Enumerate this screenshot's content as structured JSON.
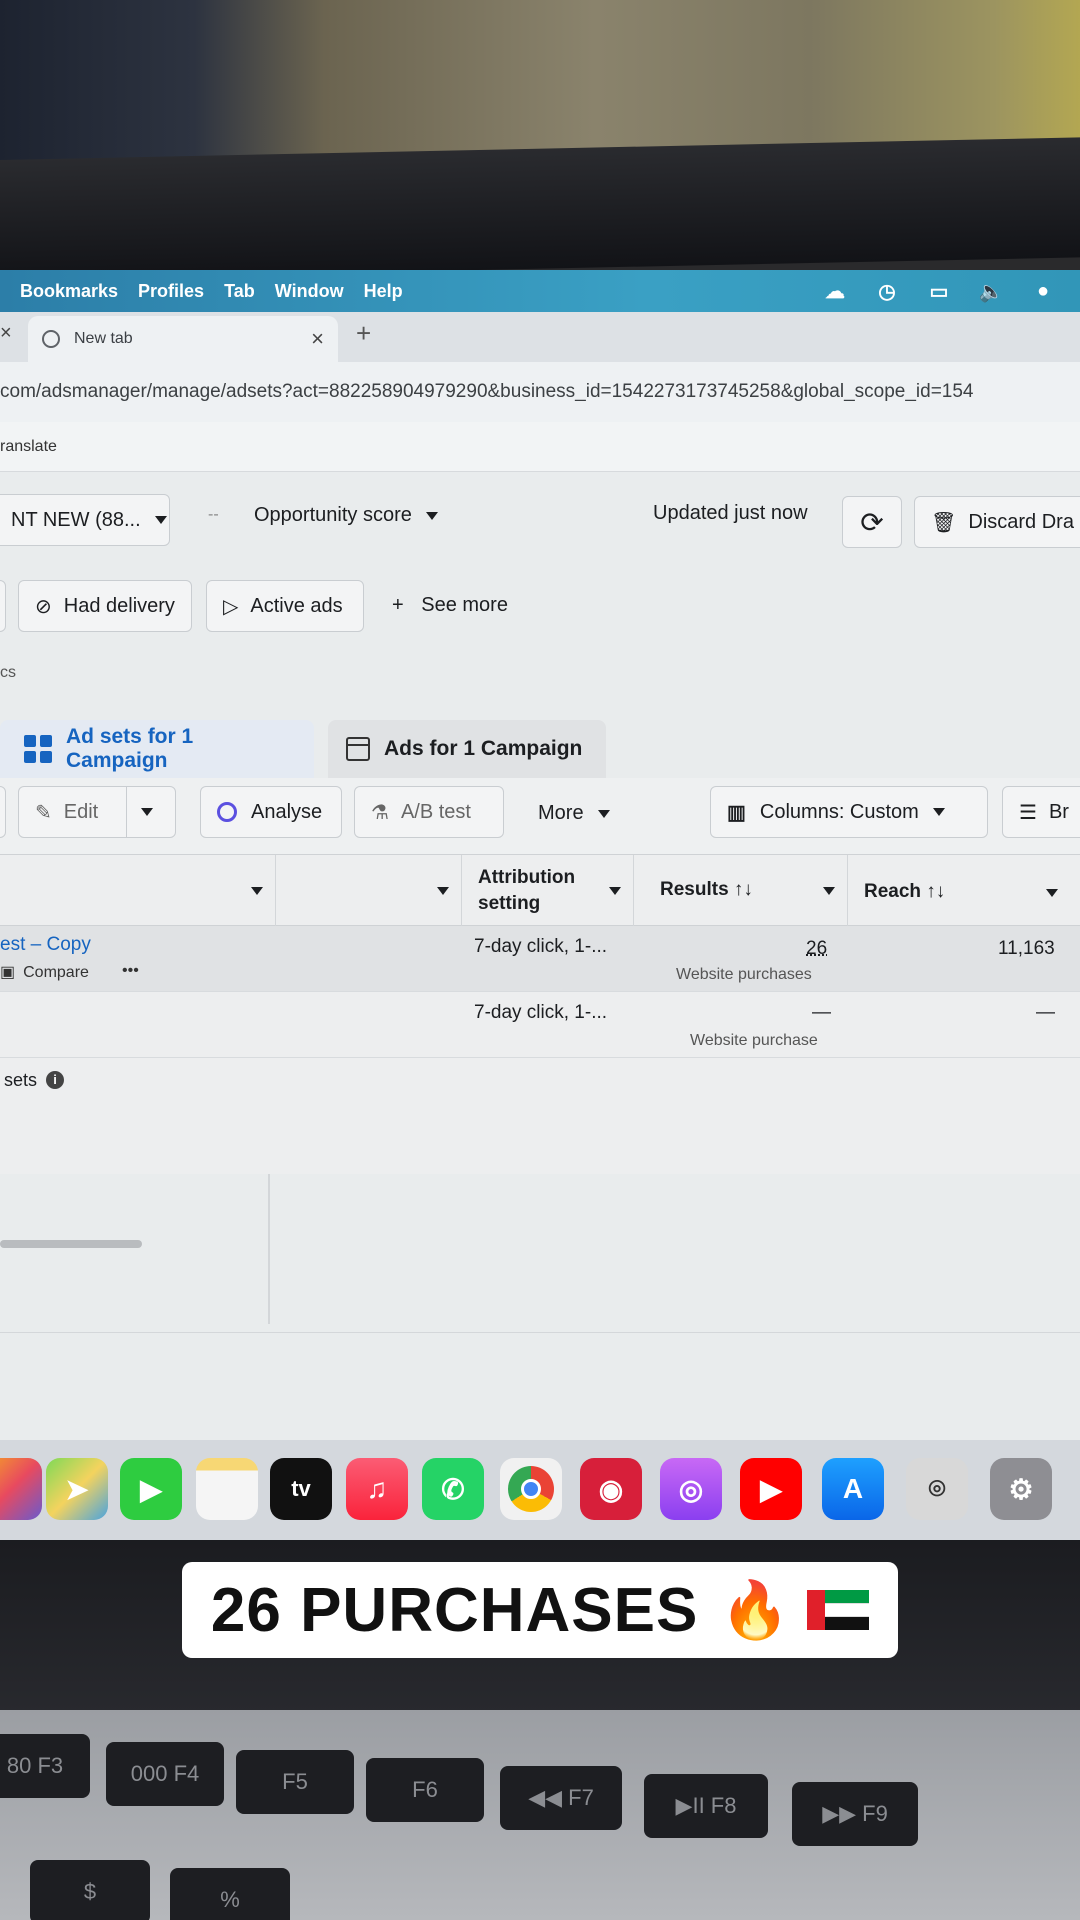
{
  "menubar": {
    "items": [
      "Bookmarks",
      "Profiles",
      "Tab",
      "Window",
      "Help"
    ]
  },
  "browser": {
    "tab_title": "New tab",
    "tab_close": "×",
    "new_tab": "+",
    "left_close": "×",
    "url": "com/adsmanager/manage/adsets?act=882258904979290&business_id=1542273173745258&global_scope_id=154",
    "bookmark_item": "ranslate"
  },
  "topbar": {
    "account_selector": "NT NEW (88...",
    "opportunity_icon": "--",
    "opportunity_label": "Opportunity score",
    "updated_text": "Updated just now",
    "discard_label": "Discard Dra"
  },
  "filters": {
    "had_delivery": "Had delivery",
    "active_ads": "Active ads",
    "see_more": "See more",
    "see_more_plus": "+"
  },
  "section_label": "cs",
  "tabs": {
    "adsets": "Ad sets for 1 Campaign",
    "ads": "Ads for 1 Campaign"
  },
  "toolbar": {
    "edit": "Edit",
    "analyse": "Analyse",
    "ab_test": "A/B test",
    "more": "More",
    "columns": "Columns: Custom",
    "breakdown": "Br"
  },
  "table": {
    "headers": {
      "attribution": "Attribution setting",
      "results": "Results ↑↓",
      "reach": "Reach ↑↓"
    },
    "rows": [
      {
        "name": "est – Copy",
        "compare": "Compare",
        "more": "•••",
        "attribution": "7-day click, 1-...",
        "results": "26",
        "results_sub": "Website purchases",
        "reach": "11,163"
      },
      {
        "attribution": "7-day click, 1-...",
        "results": "—",
        "results_sub": "Website purchase",
        "reach": "—"
      }
    ],
    "footer_label": "sets",
    "footer_info": "i"
  },
  "dock": {
    "apps": [
      "photos",
      "maps",
      "facetime",
      "notes",
      "tv",
      "music",
      "whatsapp",
      "chrome",
      "photo-booth",
      "podcasts",
      "youtube",
      "app-store",
      "screenshot",
      "settings"
    ],
    "tv_label": "tv"
  },
  "caption": {
    "text": "26 PURCHASES",
    "fire": "🔥"
  },
  "keyboard": {
    "keys": [
      "80 F3",
      "000 F4",
      "F5",
      "F6",
      "◀◀ F7",
      "▶II F8",
      "▶▶ F9"
    ],
    "bottom_keys": [
      "$",
      "%"
    ]
  },
  "colors": {
    "accent_blue": "#1664c0",
    "menubar": "#3aa0c4"
  }
}
